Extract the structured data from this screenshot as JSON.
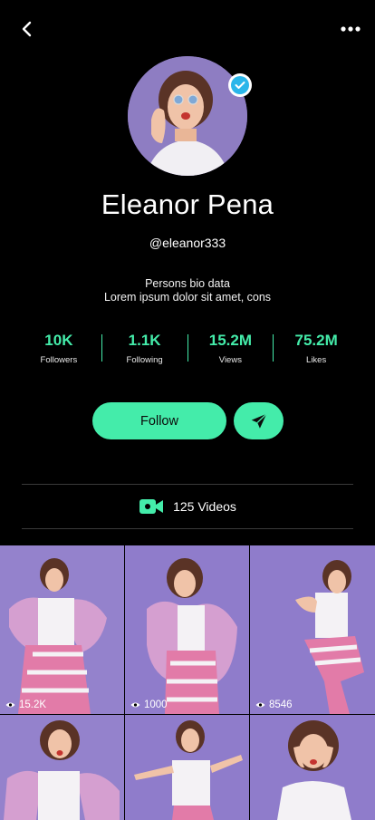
{
  "colors": {
    "accent": "#44ecaa",
    "background": "#000000",
    "verified": "#2ab6ea",
    "photo_bg": "#8f7fc8"
  },
  "header": {
    "back_icon": "chevron-left-icon",
    "more_icon": "more-horizontal-icon"
  },
  "profile": {
    "name": "Eleanor Pena",
    "handle": "@eleanor333",
    "verified": true,
    "bio_title": "Persons bio data",
    "bio_text": "Lorem ipsum dolor sit amet, cons"
  },
  "stats": [
    {
      "value": "10K",
      "label": "Followers"
    },
    {
      "value": "1.1K",
      "label": "Following"
    },
    {
      "value": "15.2M",
      "label": "Views"
    },
    {
      "value": "75.2M",
      "label": "Likes"
    }
  ],
  "actions": {
    "follow_label": "Follow",
    "send_icon": "send-icon"
  },
  "videos": {
    "label": "125 Videos",
    "icon": "video-camera-icon"
  },
  "grid": [
    {
      "views": "15.2K"
    },
    {
      "views": "1000"
    },
    {
      "views": "8546"
    },
    {
      "views": ""
    },
    {
      "views": ""
    },
    {
      "views": ""
    }
  ]
}
